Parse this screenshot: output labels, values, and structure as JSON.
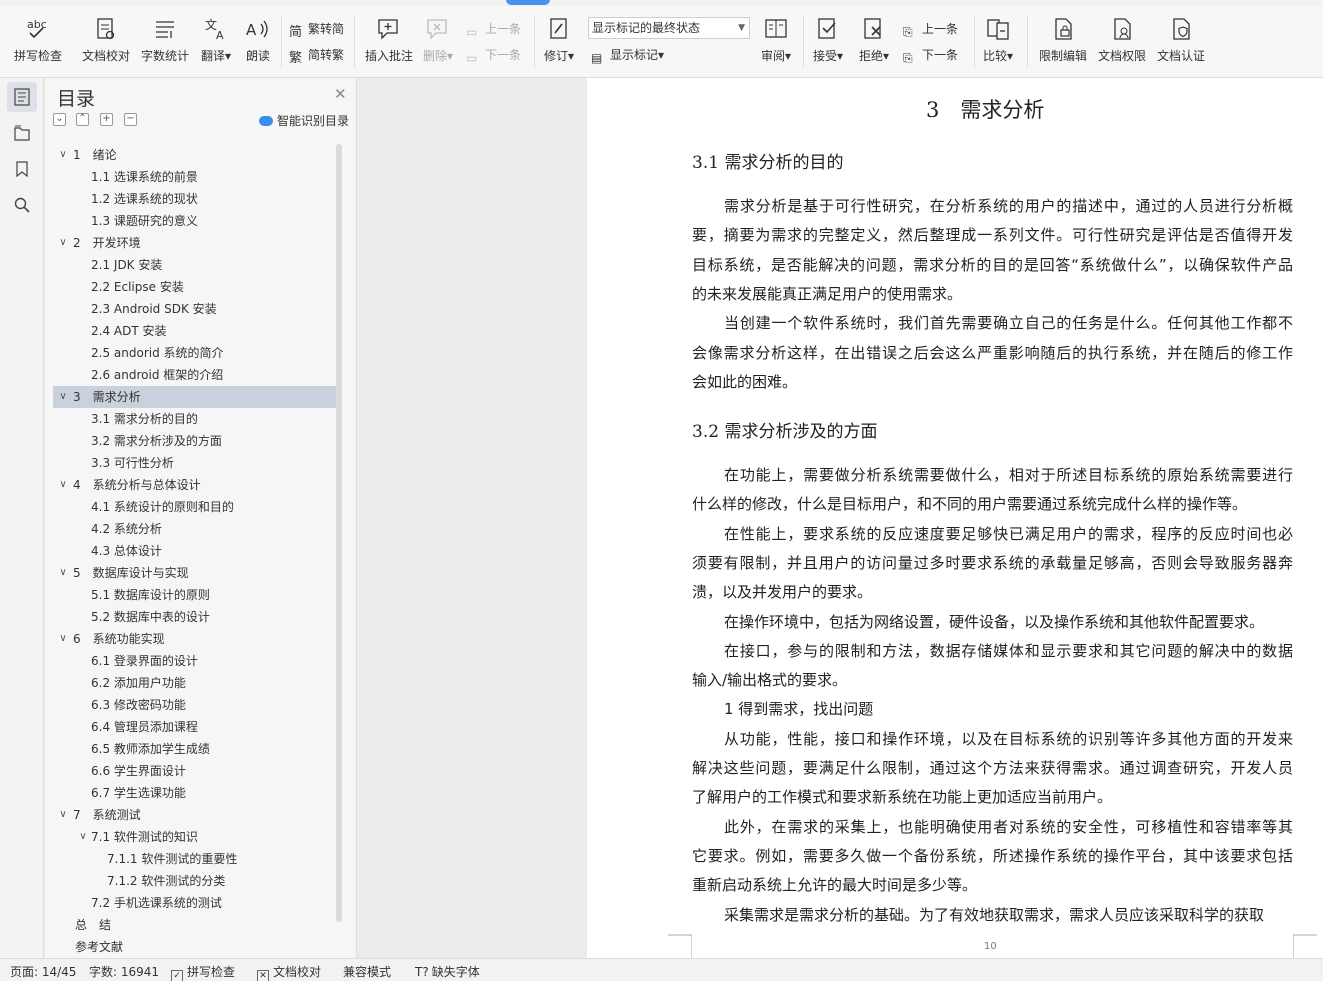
{
  "ribbon": {
    "spell_check": "拼写检查",
    "doc_proof": "文档校对",
    "word_count": "字数统计",
    "translate": "翻译",
    "read_aloud": "朗读",
    "trad_to_simp": "繁转简",
    "simp_to_trad": "简转繁",
    "insert_comment": "插入批注",
    "delete": "删除",
    "prev_comment": "上一条",
    "next_comment": "下一条",
    "revise": "修订",
    "markup_mode": "显示标记的最终状态",
    "show_markup": "显示标记",
    "review": "审阅",
    "accept": "接受",
    "reject": "拒绝",
    "prev_change": "上一条",
    "next_change": "下一条",
    "compare": "比较",
    "restrict_edit": "限制编辑",
    "doc_permission": "文档权限",
    "doc_cert": "文档认证"
  },
  "toc": {
    "title": "目录",
    "smart_toc": "智能识别目录",
    "items": [
      {
        "label": "1　绪论",
        "level": 1,
        "expanded": true
      },
      {
        "label": "1.1  选课系统的前景",
        "level": 2
      },
      {
        "label": "1.2  选课系统的现状",
        "level": 2
      },
      {
        "label": "1.3  课题研究的意义",
        "level": 2
      },
      {
        "label": "2　开发环境",
        "level": 1,
        "expanded": true
      },
      {
        "label": "2.1 JDK 安装",
        "level": 2
      },
      {
        "label": "2.2 Eclipse 安装",
        "level": 2
      },
      {
        "label": "2.3 Android SDK 安装",
        "level": 2
      },
      {
        "label": "2.4 ADT 安装",
        "level": 2
      },
      {
        "label": "2.5 andorid 系统的简介",
        "level": 2
      },
      {
        "label": "2.6 android 框架的介绍",
        "level": 2
      },
      {
        "label": "3　需求分析",
        "level": 1,
        "expanded": true,
        "selected": true
      },
      {
        "label": "3.1 需求分析的目的",
        "level": 2
      },
      {
        "label": "3.2 需求分析涉及的方面",
        "level": 2
      },
      {
        "label": "3.3 可行性分析",
        "level": 2
      },
      {
        "label": "4　系统分析与总体设计",
        "level": 1,
        "expanded": true
      },
      {
        "label": "4.1 系统设计的原则和目的",
        "level": 2
      },
      {
        "label": "4.2 系统分析",
        "level": 2
      },
      {
        "label": "4.3  总体设计",
        "level": 2
      },
      {
        "label": "5　数据库设计与实现",
        "level": 1,
        "expanded": true
      },
      {
        "label": "5.1 数据库设计的原则",
        "level": 2
      },
      {
        "label": "5.2 数据库中表的设计",
        "level": 2
      },
      {
        "label": "6　系统功能实现",
        "level": 1,
        "expanded": true
      },
      {
        "label": "6.1 登录界面的设计",
        "level": 2
      },
      {
        "label": "6.2 添加用户功能",
        "level": 2
      },
      {
        "label": "6.3 修改密码功能",
        "level": 2
      },
      {
        "label": "6.4 管理员添加课程",
        "level": 2
      },
      {
        "label": "6.5 教师添加学生成绩",
        "level": 2
      },
      {
        "label": "6.6 学生界面设计",
        "level": 2
      },
      {
        "label": "6.7 学生选课功能",
        "level": 2
      },
      {
        "label": "7　系统测试",
        "level": 1,
        "expanded": true
      },
      {
        "label": "7.1  软件测试的知识",
        "level": 2,
        "expanded": true
      },
      {
        "label": "7.1.1  软件测试的重要性",
        "level": 3
      },
      {
        "label": "7.1.2  软件测试的分类",
        "level": 3
      },
      {
        "label": "7.2 手机选课系统的测试",
        "level": 2
      },
      {
        "label": "总　结",
        "level": 0
      },
      {
        "label": "参考文献",
        "level": 0
      }
    ]
  },
  "document": {
    "chapter_title": "3　需求分析",
    "section1_title": "3.1 需求分析的目的",
    "section1_lines": [
      "需求分析是基于可行性研究，在分析系统的用户的描述中，通过的人员进行分析概",
      "要，摘要为需求的完整定义，然后整理成一系列文件。可行性研究是评估是否值得开发",
      "目标系统，是否能解决的问题，需求分析的目的是回答“系统做什么”，以确保软件产品",
      "的未来发展能真正满足用户的使用需求。",
      "当创建一个软件系统时，我们首先需要确立自己的任务是什么。任何其他工作都不",
      "会像需求分析这样，在出错误之后会这么严重影响随后的执行系统，并在随后的修工作",
      "会如此的困难。"
    ],
    "section2_title": "3.2 需求分析涉及的方面",
    "section2_lines": [
      "在功能上，需要做分析系统需要做什么，相对于所述目标系统的原始系统需要进行",
      "什么样的修改，什么是目标用户，和不同的用户需要通过系统完成什么样的操作等。",
      "在性能上，要求系统的反应速度要足够快已满足用户的需求，程序的反应时间也必",
      "须要有限制，并且用户的访问量过多时要求系统的承载量足够高，否则会导致服务器奔",
      "溃，以及并发用户的要求。",
      "在操作环境中，包括为网络设置，硬件设备，以及操作系统和其他软件配置要求。",
      "在接口，参与的限制和方法，数据存储媒体和显示要求和其它问题的解决中的数据",
      "输入/输出格式的要求。",
      "1 得到需求，找出问题",
      "从功能，性能，接口和操作环境，以及在目标系统的识别等许多其他方面的开发来",
      "解决这些问题，要满足什么限制，通过这个方法来获得需求。通过调查研究，开发人员",
      "了解用户的工作模式和要求新系统在功能上更加适应当前用户。",
      "此外，在需求的采集上，也能明确使用者对系统的安全性，可移植性和容错率等其",
      "它要求。例如，需要多久做一个备份系统，所述操作系统的操作平台，其中该要求包括",
      "重新启动系统上允许的最大时间是多少等。",
      "采集需求是需求分析的基础。为了有效地获取需求，需求人员应该采取科学的获取"
    ],
    "page_number": "10"
  },
  "status": {
    "page": "页面: 14/45",
    "words": "字数: 16941",
    "spell": "拼写检查",
    "proof": "文档校对",
    "compat": "兼容模式",
    "missing_font": "缺失字体"
  },
  "colors": {
    "accent": "#3b8df0",
    "selected_row": "#c9d1dc"
  }
}
